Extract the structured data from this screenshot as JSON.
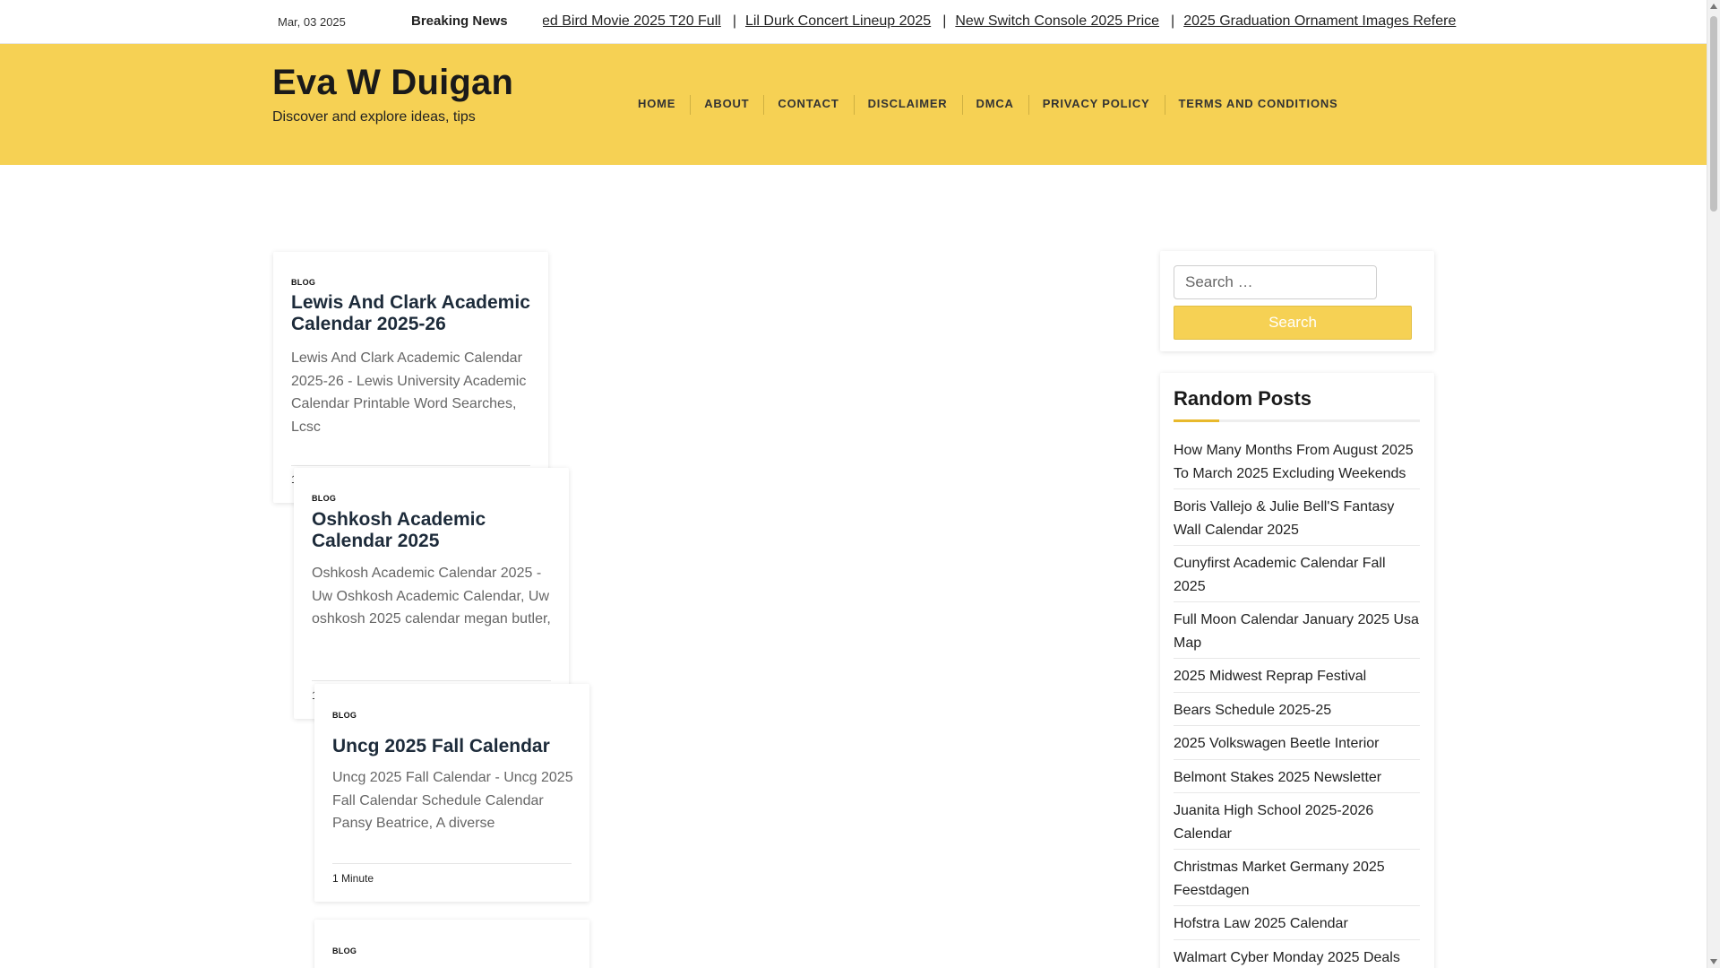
{
  "topbar": {
    "date": "Mar, 03 2025",
    "breaking_label": "Breaking News",
    "ticker": [
      "ed Bird Movie 2025 T20 Full",
      "Lil Durk Concert Lineup 2025",
      "New Switch Console 2025 Price",
      "2025 Graduation Ornament Images Refere"
    ],
    "ticker_separator": "|"
  },
  "header": {
    "site_title": "Eva W Duigan",
    "tagline": "Discover and explore ideas, tips",
    "nav": [
      "HOME",
      "ABOUT",
      "CONTACT",
      "DISCLAIMER",
      "DMCA",
      "PRIVACY POLICY",
      "TERMS AND CONDITIONS"
    ]
  },
  "posts": [
    {
      "category": "BLOG",
      "title": "Lewis And Clark Academic Calendar 2025-26",
      "excerpt": "Lewis And Clark Academic Calendar 2025-26 - Lewis University Academic Calendar Printable Word Searches, Lcsc",
      "meta": "1"
    },
    {
      "category": "BLOG",
      "title": "Oshkosh Academic Calendar 2025",
      "excerpt": "Oshkosh Academic Calendar 2025 - Uw Oshkosh Academic Calendar, Uw oshkosh 2025 calendar megan butler,",
      "meta": "1"
    },
    {
      "category": "BLOG",
      "title": "Uncg 2025 Fall Calendar",
      "excerpt": "Uncg 2025 Fall Calendar - Uncg 2025 Fall Calendar Schedule Calendar Pansy Beatrice, A diverse",
      "meta": "1 Minute"
    },
    {
      "category": "BLOG"
    }
  ],
  "sidebar": {
    "search": {
      "placeholder": "Search …",
      "button": "Search"
    },
    "random_posts": {
      "title": "Random Posts",
      "items": [
        "How Many Months From August 2025 To March 2025 Excluding Weekends",
        "Boris Vallejo & Julie Bell'S Fantasy Wall Calendar 2025",
        "Cunyfirst Academic Calendar Fall 2025",
        "Full Moon Calendar January 2025 Usa Map",
        "2025 Midwest Reprap Festival",
        "Bears Schedule 2025-25",
        "2025 Volkswagen Beetle Interior",
        "Belmont Stakes 2025 Newsletter",
        "Juanita High School 2025-2026 Calendar",
        "Christmas Market Germany 2025 Feestdagen",
        "Hofstra Law 2025 Calendar",
        "Walmart Cyber Monday 2025 Deals"
      ]
    }
  },
  "colors": {
    "brand_yellow": "#f6d154",
    "accent_underline": "#e8b92c",
    "title_navy": "#1d2b3a"
  }
}
